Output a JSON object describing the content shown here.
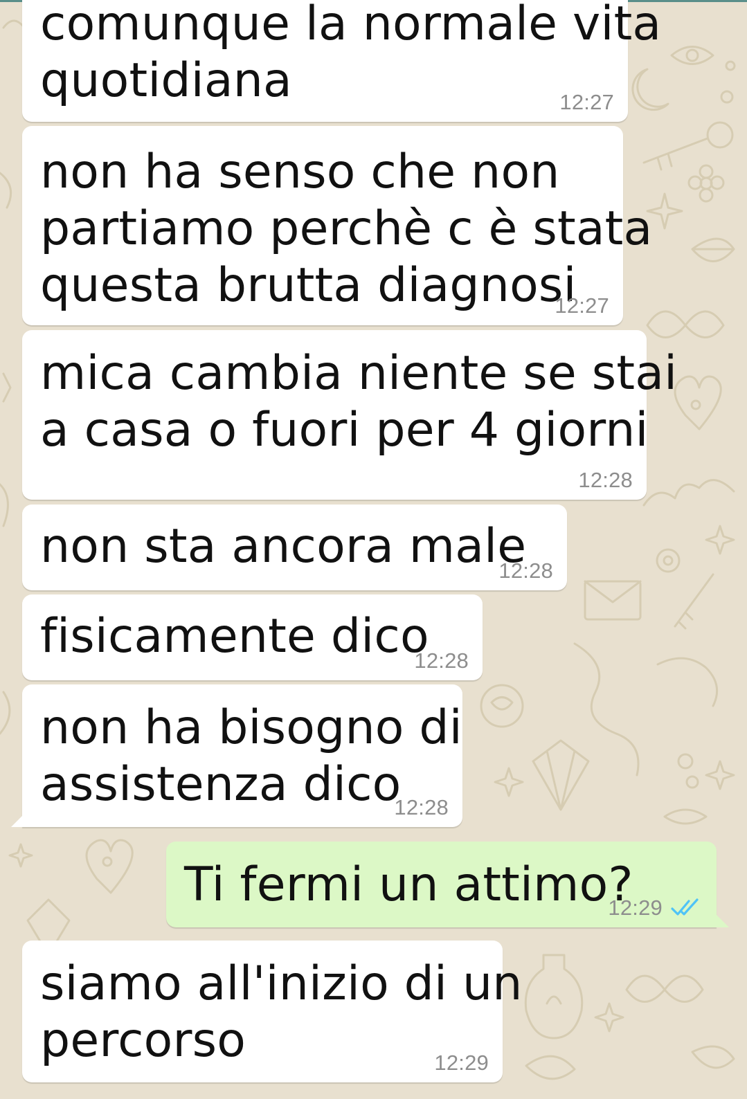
{
  "messages": [
    {
      "direction": "incoming",
      "lines": [
        "comunque la normale vita",
        "quotidiana"
      ],
      "time": "12:27"
    },
    {
      "direction": "incoming",
      "lines": [
        "non ha senso che non",
        "partiamo perchè c è stata",
        "questa brutta diagnosi"
      ],
      "time": "12:27"
    },
    {
      "direction": "incoming",
      "lines": [
        "mica cambia niente se stai",
        "a casa o fuori per 4 giorni"
      ],
      "time": "12:28"
    },
    {
      "direction": "incoming",
      "lines": [
        "non sta ancora male"
      ],
      "time": "12:28"
    },
    {
      "direction": "incoming",
      "lines": [
        "fisicamente dico"
      ],
      "time": "12:28"
    },
    {
      "direction": "incoming",
      "lines": [
        "non ha bisogno di",
        "assistenza dico"
      ],
      "time": "12:28"
    },
    {
      "direction": "outgoing",
      "lines": [
        "Ti fermi un attimo?"
      ],
      "time": "12:29",
      "status": "read"
    },
    {
      "direction": "incoming",
      "lines": [
        "siamo all'inizio di un",
        "percorso"
      ],
      "time": "12:29"
    }
  ],
  "colors": {
    "wallpaper": "#e8e0cf",
    "incoming_bubble": "#ffffff",
    "outgoing_bubble": "#dcf8c6",
    "timestamp": "#8d8d8d",
    "read_ticks": "#4fc3f7"
  },
  "icons": {
    "read_receipt": "double-check-icon"
  }
}
